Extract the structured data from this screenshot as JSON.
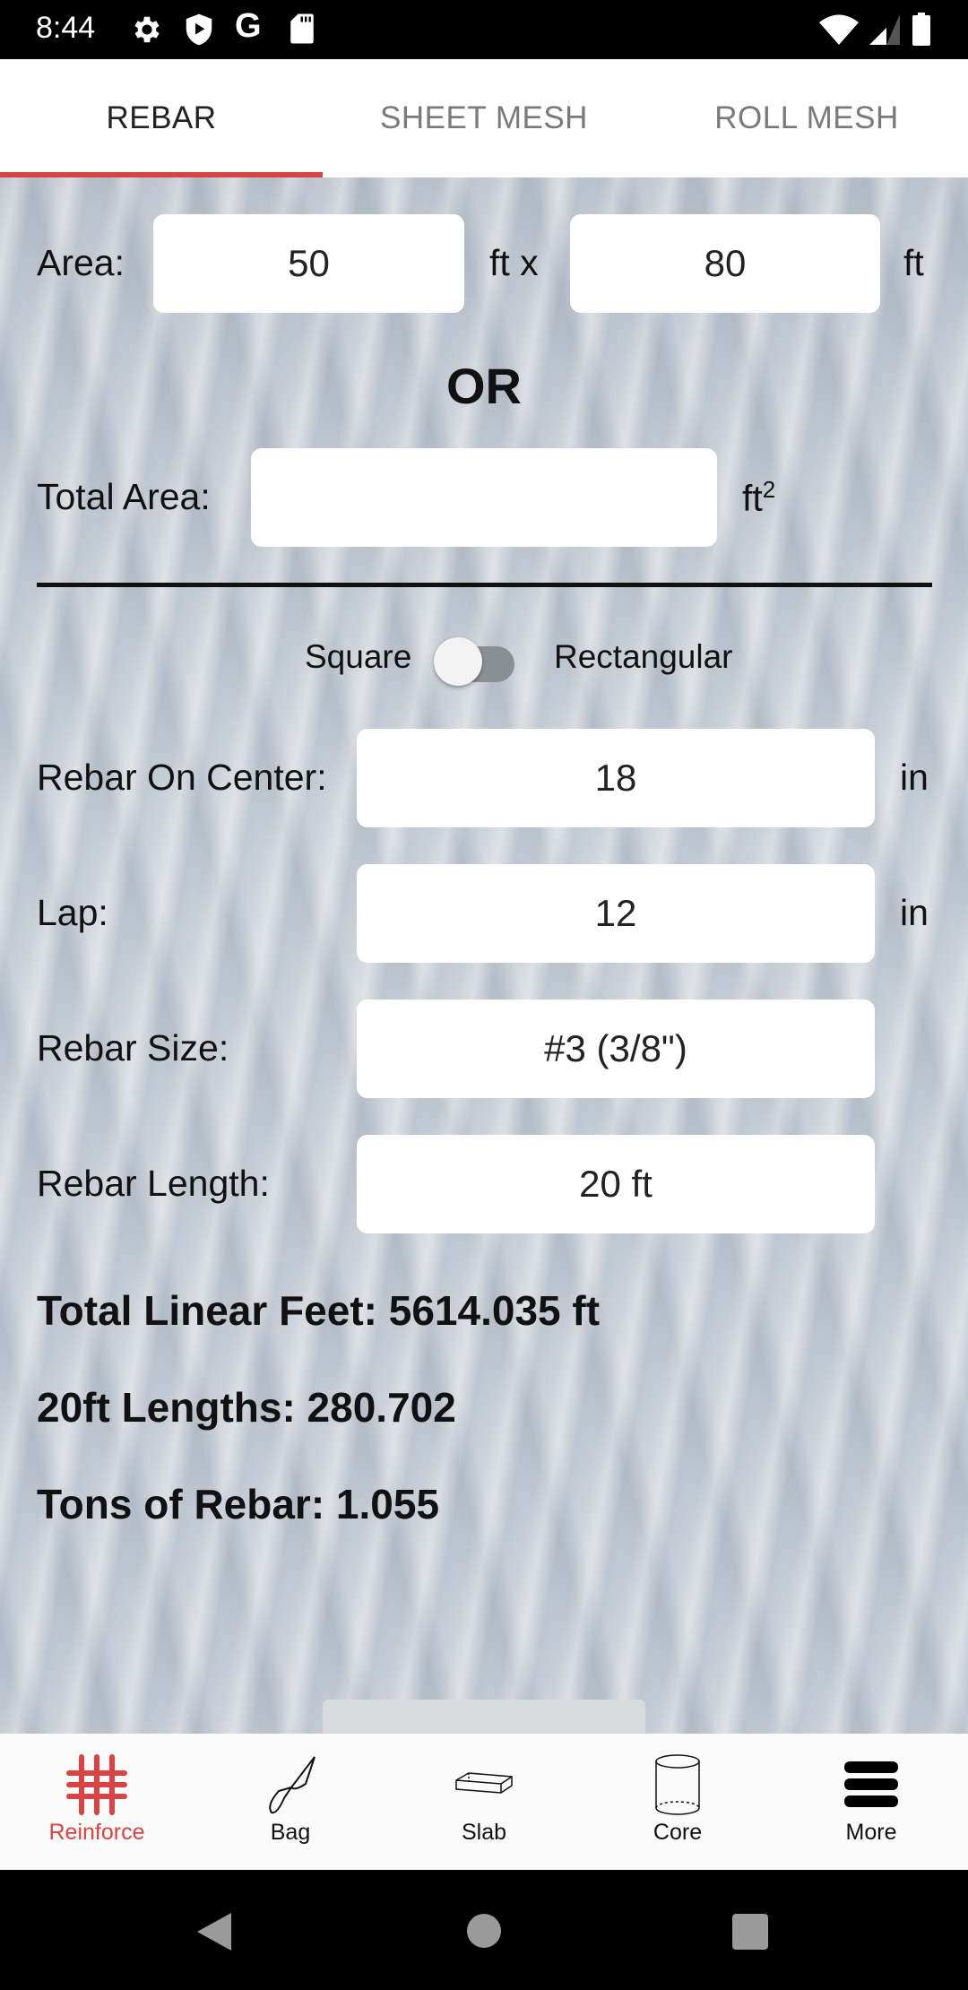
{
  "status_bar": {
    "time": "8:44",
    "icons": [
      "gear-icon",
      "shield-play-icon",
      "google-icon",
      "sd-card-icon",
      "wifi-icon",
      "signal-icon",
      "battery-icon"
    ],
    "google_glyph": "G"
  },
  "tabs": [
    {
      "label": "REBAR",
      "active": true
    },
    {
      "label": "SHEET MESH",
      "active": false
    },
    {
      "label": "ROLL MESH",
      "active": false
    }
  ],
  "form": {
    "area_label": "Area:",
    "area_width": "50",
    "area_mid_unit": "ft x",
    "area_length": "80",
    "area_end_unit": "ft",
    "or_label": "OR",
    "total_area_label": "Total Area:",
    "total_area_value": "",
    "total_area_unit": "ft",
    "total_area_unit_sup": "2",
    "toggle_left": "Square",
    "toggle_right": "Rectangular",
    "toggle_on": false,
    "on_center_label": "Rebar On Center:",
    "on_center_value": "18",
    "on_center_unit": "in",
    "lap_label": "Lap:",
    "lap_value": "12",
    "lap_unit": "in",
    "size_label": "Rebar Size:",
    "size_value": "#3 (3/8\")",
    "length_label": "Rebar Length:",
    "length_value": "20 ft"
  },
  "results": {
    "total_linear_feet": "Total Linear Feet: 5614.035 ft",
    "lengths": "20ft Lengths: 280.702",
    "tons": "Tons of Rebar: 1.055"
  },
  "bottom_nav": [
    {
      "label": "Reinforce",
      "icon": "grid-icon",
      "active": true
    },
    {
      "label": "Bag",
      "icon": "trowel-icon",
      "active": false
    },
    {
      "label": "Slab",
      "icon": "slab-icon",
      "active": false
    },
    {
      "label": "Core",
      "icon": "cylinder-icon",
      "active": false
    },
    {
      "label": "More",
      "icon": "menu-icon",
      "active": false
    }
  ],
  "colors": {
    "accent": "#d84343",
    "tab_inactive": "#7a7a7a",
    "field_bg": "#ffffff"
  }
}
